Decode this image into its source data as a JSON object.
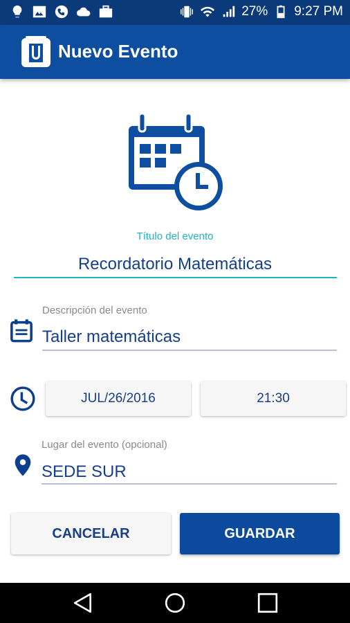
{
  "status_bar": {
    "battery": "27%",
    "time": "9:27 PM",
    "icons": [
      "lightbulb-icon",
      "image-icon",
      "phone-icon",
      "cloud-icon",
      "briefcase-icon",
      "vibrate-icon",
      "wifi-icon",
      "signal-icon",
      "battery-icon"
    ]
  },
  "app_bar": {
    "title": "Nuevo Evento"
  },
  "form": {
    "title_label": "Título del evento",
    "title_value": "Recordatorio Matemáticas",
    "description_label": "Descripción del evento",
    "description_value": "Taller matemáticas",
    "date_button": "JUL/26/2016",
    "time_button": "21:30",
    "place_label": "Lugar del evento (opcional)",
    "place_value": "SEDE SUR"
  },
  "actions": {
    "cancel": "CANCELAR",
    "save": "GUARDAR"
  },
  "colors": {
    "primary": "#0d4ea0",
    "status_bar": "#0a3a7a",
    "accent": "#1fb3c5",
    "text": "#153f8a"
  }
}
